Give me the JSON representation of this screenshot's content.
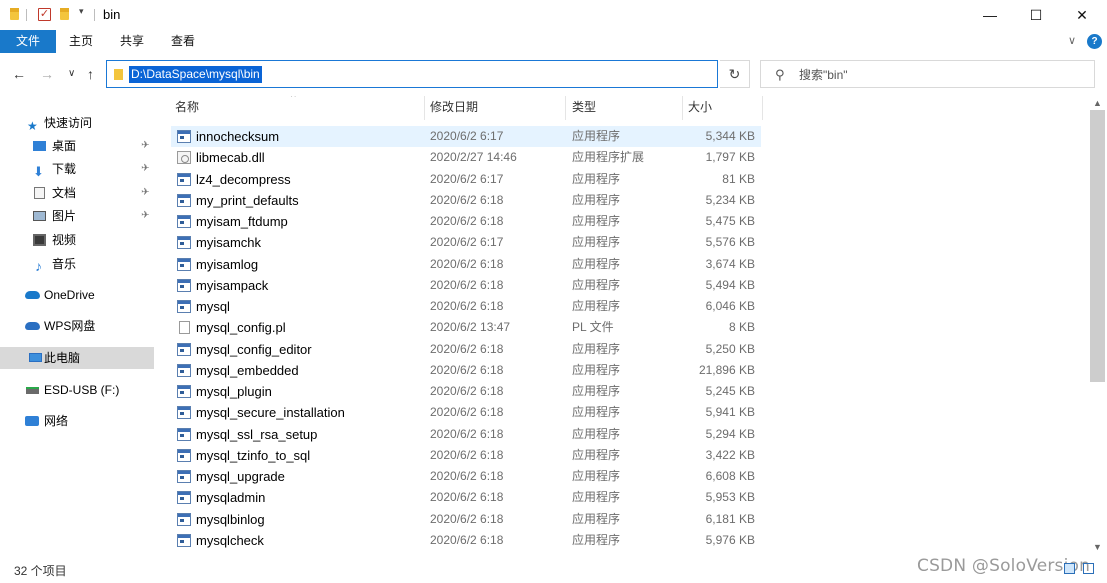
{
  "window": {
    "title": "bin",
    "minimize_glyph": "—",
    "maximize_glyph": "☐",
    "close_glyph": "✕"
  },
  "ribbon": {
    "tabs": [
      "文件",
      "主页",
      "共享",
      "查看"
    ],
    "expand_glyph": "∨",
    "help_glyph": "?"
  },
  "nav": {
    "back_glyph": "←",
    "forward_glyph": "→",
    "recent_glyph": "∨",
    "up_glyph": "↑",
    "refresh_glyph": "↻",
    "address": "D:\\DataSpace\\mysql\\bin",
    "address_drop_glyph": "∨",
    "search_glyph": "⚲",
    "search_placeholder": "搜索\"bin\""
  },
  "sidebar": {
    "items": [
      {
        "label": "快速访问",
        "icon": "star-icon"
      },
      {
        "label": "桌面",
        "icon": "desktop-icon",
        "pinned": true
      },
      {
        "label": "下载",
        "icon": "download-icon",
        "pinned": true
      },
      {
        "label": "文档",
        "icon": "document-icon",
        "pinned": true
      },
      {
        "label": "图片",
        "icon": "picture-icon",
        "pinned": true
      },
      {
        "label": "视频",
        "icon": "video-icon"
      },
      {
        "label": "音乐",
        "icon": "music-icon"
      },
      {
        "label": "OneDrive",
        "icon": "cloud-icon"
      },
      {
        "label": "WPS网盘",
        "icon": "cloud-drive-icon"
      },
      {
        "label": "此电脑",
        "icon": "computer-icon",
        "selected": true
      },
      {
        "label": "ESD-USB (F:)",
        "icon": "usb-drive-icon"
      },
      {
        "label": "网络",
        "icon": "network-icon"
      }
    ],
    "pin_glyph": "📌"
  },
  "columns": {
    "name": "名称",
    "date": "修改日期",
    "type": "类型",
    "size": "大小",
    "sort_glyph": "^"
  },
  "files": [
    {
      "name": "innochecksum",
      "date": "2020/6/2 6:17",
      "type": "应用程序",
      "size": "5,344 KB",
      "icon": "exe"
    },
    {
      "name": "libmecab.dll",
      "date": "2020/2/27 14:46",
      "type": "应用程序扩展",
      "size": "1,797 KB",
      "icon": "dll"
    },
    {
      "name": "lz4_decompress",
      "date": "2020/6/2 6:17",
      "type": "应用程序",
      "size": "81 KB",
      "icon": "exe"
    },
    {
      "name": "my_print_defaults",
      "date": "2020/6/2 6:18",
      "type": "应用程序",
      "size": "5,234 KB",
      "icon": "exe"
    },
    {
      "name": "myisam_ftdump",
      "date": "2020/6/2 6:18",
      "type": "应用程序",
      "size": "5,475 KB",
      "icon": "exe"
    },
    {
      "name": "myisamchk",
      "date": "2020/6/2 6:17",
      "type": "应用程序",
      "size": "5,576 KB",
      "icon": "exe"
    },
    {
      "name": "myisamlog",
      "date": "2020/6/2 6:18",
      "type": "应用程序",
      "size": "3,674 KB",
      "icon": "exe"
    },
    {
      "name": "myisampack",
      "date": "2020/6/2 6:18",
      "type": "应用程序",
      "size": "5,494 KB",
      "icon": "exe"
    },
    {
      "name": "mysql",
      "date": "2020/6/2 6:18",
      "type": "应用程序",
      "size": "6,046 KB",
      "icon": "exe"
    },
    {
      "name": "mysql_config.pl",
      "date": "2020/6/2 13:47",
      "type": "PL 文件",
      "size": "8 KB",
      "icon": "doc"
    },
    {
      "name": "mysql_config_editor",
      "date": "2020/6/2 6:18",
      "type": "应用程序",
      "size": "5,250 KB",
      "icon": "exe"
    },
    {
      "name": "mysql_embedded",
      "date": "2020/6/2 6:18",
      "type": "应用程序",
      "size": "21,896 KB",
      "icon": "exe"
    },
    {
      "name": "mysql_plugin",
      "date": "2020/6/2 6:18",
      "type": "应用程序",
      "size": "5,245 KB",
      "icon": "exe"
    },
    {
      "name": "mysql_secure_installation",
      "date": "2020/6/2 6:18",
      "type": "应用程序",
      "size": "5,941 KB",
      "icon": "exe"
    },
    {
      "name": "mysql_ssl_rsa_setup",
      "date": "2020/6/2 6:18",
      "type": "应用程序",
      "size": "5,294 KB",
      "icon": "exe"
    },
    {
      "name": "mysql_tzinfo_to_sql",
      "date": "2020/6/2 6:18",
      "type": "应用程序",
      "size": "3,422 KB",
      "icon": "exe"
    },
    {
      "name": "mysql_upgrade",
      "date": "2020/6/2 6:18",
      "type": "应用程序",
      "size": "6,608 KB",
      "icon": "exe"
    },
    {
      "name": "mysqladmin",
      "date": "2020/6/2 6:18",
      "type": "应用程序",
      "size": "5,953 KB",
      "icon": "exe"
    },
    {
      "name": "mysqlbinlog",
      "date": "2020/6/2 6:18",
      "type": "应用程序",
      "size": "6,181 KB",
      "icon": "exe"
    },
    {
      "name": "mysqlcheck",
      "date": "2020/6/2 6:18",
      "type": "应用程序",
      "size": "5,976 KB",
      "icon": "exe"
    }
  ],
  "status": {
    "item_count": "32 个项目"
  },
  "watermark": "CSDN @SoloVersion",
  "colors": {
    "accent": "#1979ca",
    "selection": "#0a64d6",
    "row_highlight": "#e5f3ff",
    "nav_selected": "#d9d9d9"
  }
}
